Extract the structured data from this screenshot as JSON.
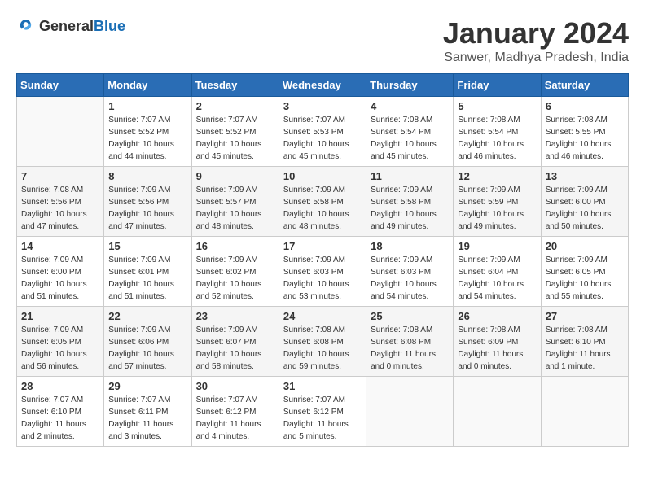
{
  "header": {
    "logo_general": "General",
    "logo_blue": "Blue",
    "month_title": "January 2024",
    "location": "Sanwer, Madhya Pradesh, India"
  },
  "days_of_week": [
    "Sunday",
    "Monday",
    "Tuesday",
    "Wednesday",
    "Thursday",
    "Friday",
    "Saturday"
  ],
  "weeks": [
    [
      {
        "day": "",
        "sunrise": "",
        "sunset": "",
        "daylight": ""
      },
      {
        "day": "1",
        "sunrise": "Sunrise: 7:07 AM",
        "sunset": "Sunset: 5:52 PM",
        "daylight": "Daylight: 10 hours and 44 minutes."
      },
      {
        "day": "2",
        "sunrise": "Sunrise: 7:07 AM",
        "sunset": "Sunset: 5:52 PM",
        "daylight": "Daylight: 10 hours and 45 minutes."
      },
      {
        "day": "3",
        "sunrise": "Sunrise: 7:07 AM",
        "sunset": "Sunset: 5:53 PM",
        "daylight": "Daylight: 10 hours and 45 minutes."
      },
      {
        "day": "4",
        "sunrise": "Sunrise: 7:08 AM",
        "sunset": "Sunset: 5:54 PM",
        "daylight": "Daylight: 10 hours and 45 minutes."
      },
      {
        "day": "5",
        "sunrise": "Sunrise: 7:08 AM",
        "sunset": "Sunset: 5:54 PM",
        "daylight": "Daylight: 10 hours and 46 minutes."
      },
      {
        "day": "6",
        "sunrise": "Sunrise: 7:08 AM",
        "sunset": "Sunset: 5:55 PM",
        "daylight": "Daylight: 10 hours and 46 minutes."
      }
    ],
    [
      {
        "day": "7",
        "sunrise": "Sunrise: 7:08 AM",
        "sunset": "Sunset: 5:56 PM",
        "daylight": "Daylight: 10 hours and 47 minutes."
      },
      {
        "day": "8",
        "sunrise": "Sunrise: 7:09 AM",
        "sunset": "Sunset: 5:56 PM",
        "daylight": "Daylight: 10 hours and 47 minutes."
      },
      {
        "day": "9",
        "sunrise": "Sunrise: 7:09 AM",
        "sunset": "Sunset: 5:57 PM",
        "daylight": "Daylight: 10 hours and 48 minutes."
      },
      {
        "day": "10",
        "sunrise": "Sunrise: 7:09 AM",
        "sunset": "Sunset: 5:58 PM",
        "daylight": "Daylight: 10 hours and 48 minutes."
      },
      {
        "day": "11",
        "sunrise": "Sunrise: 7:09 AM",
        "sunset": "Sunset: 5:58 PM",
        "daylight": "Daylight: 10 hours and 49 minutes."
      },
      {
        "day": "12",
        "sunrise": "Sunrise: 7:09 AM",
        "sunset": "Sunset: 5:59 PM",
        "daylight": "Daylight: 10 hours and 49 minutes."
      },
      {
        "day": "13",
        "sunrise": "Sunrise: 7:09 AM",
        "sunset": "Sunset: 6:00 PM",
        "daylight": "Daylight: 10 hours and 50 minutes."
      }
    ],
    [
      {
        "day": "14",
        "sunrise": "Sunrise: 7:09 AM",
        "sunset": "Sunset: 6:00 PM",
        "daylight": "Daylight: 10 hours and 51 minutes."
      },
      {
        "day": "15",
        "sunrise": "Sunrise: 7:09 AM",
        "sunset": "Sunset: 6:01 PM",
        "daylight": "Daylight: 10 hours and 51 minutes."
      },
      {
        "day": "16",
        "sunrise": "Sunrise: 7:09 AM",
        "sunset": "Sunset: 6:02 PM",
        "daylight": "Daylight: 10 hours and 52 minutes."
      },
      {
        "day": "17",
        "sunrise": "Sunrise: 7:09 AM",
        "sunset": "Sunset: 6:03 PM",
        "daylight": "Daylight: 10 hours and 53 minutes."
      },
      {
        "day": "18",
        "sunrise": "Sunrise: 7:09 AM",
        "sunset": "Sunset: 6:03 PM",
        "daylight": "Daylight: 10 hours and 54 minutes."
      },
      {
        "day": "19",
        "sunrise": "Sunrise: 7:09 AM",
        "sunset": "Sunset: 6:04 PM",
        "daylight": "Daylight: 10 hours and 54 minutes."
      },
      {
        "day": "20",
        "sunrise": "Sunrise: 7:09 AM",
        "sunset": "Sunset: 6:05 PM",
        "daylight": "Daylight: 10 hours and 55 minutes."
      }
    ],
    [
      {
        "day": "21",
        "sunrise": "Sunrise: 7:09 AM",
        "sunset": "Sunset: 6:05 PM",
        "daylight": "Daylight: 10 hours and 56 minutes."
      },
      {
        "day": "22",
        "sunrise": "Sunrise: 7:09 AM",
        "sunset": "Sunset: 6:06 PM",
        "daylight": "Daylight: 10 hours and 57 minutes."
      },
      {
        "day": "23",
        "sunrise": "Sunrise: 7:09 AM",
        "sunset": "Sunset: 6:07 PM",
        "daylight": "Daylight: 10 hours and 58 minutes."
      },
      {
        "day": "24",
        "sunrise": "Sunrise: 7:08 AM",
        "sunset": "Sunset: 6:08 PM",
        "daylight": "Daylight: 10 hours and 59 minutes."
      },
      {
        "day": "25",
        "sunrise": "Sunrise: 7:08 AM",
        "sunset": "Sunset: 6:08 PM",
        "daylight": "Daylight: 11 hours and 0 minutes."
      },
      {
        "day": "26",
        "sunrise": "Sunrise: 7:08 AM",
        "sunset": "Sunset: 6:09 PM",
        "daylight": "Daylight: 11 hours and 0 minutes."
      },
      {
        "day": "27",
        "sunrise": "Sunrise: 7:08 AM",
        "sunset": "Sunset: 6:10 PM",
        "daylight": "Daylight: 11 hours and 1 minute."
      }
    ],
    [
      {
        "day": "28",
        "sunrise": "Sunrise: 7:07 AM",
        "sunset": "Sunset: 6:10 PM",
        "daylight": "Daylight: 11 hours and 2 minutes."
      },
      {
        "day": "29",
        "sunrise": "Sunrise: 7:07 AM",
        "sunset": "Sunset: 6:11 PM",
        "daylight": "Daylight: 11 hours and 3 minutes."
      },
      {
        "day": "30",
        "sunrise": "Sunrise: 7:07 AM",
        "sunset": "Sunset: 6:12 PM",
        "daylight": "Daylight: 11 hours and 4 minutes."
      },
      {
        "day": "31",
        "sunrise": "Sunrise: 7:07 AM",
        "sunset": "Sunset: 6:12 PM",
        "daylight": "Daylight: 11 hours and 5 minutes."
      },
      {
        "day": "",
        "sunrise": "",
        "sunset": "",
        "daylight": ""
      },
      {
        "day": "",
        "sunrise": "",
        "sunset": "",
        "daylight": ""
      },
      {
        "day": "",
        "sunrise": "",
        "sunset": "",
        "daylight": ""
      }
    ]
  ]
}
